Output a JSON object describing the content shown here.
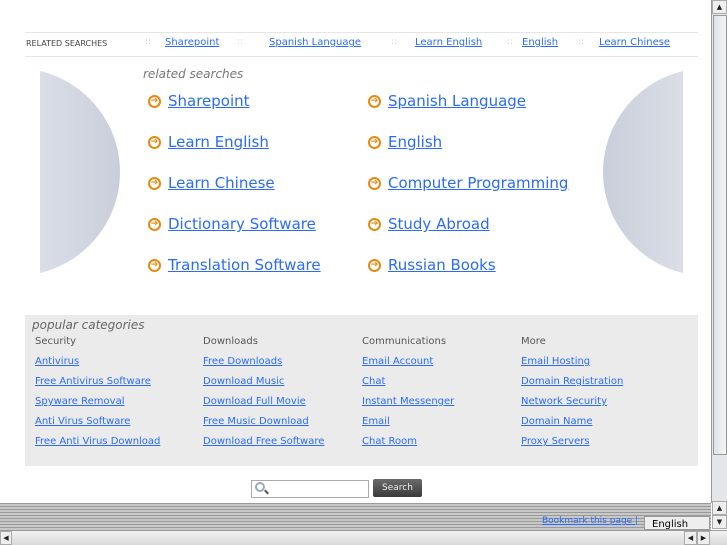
{
  "topbar": {
    "label": "RELATED SEARCHES",
    "links": [
      "Sharepoint",
      "Spanish Language",
      "Learn English",
      "English",
      "Learn Chinese"
    ],
    "separator": "::"
  },
  "related": {
    "title": "related searches",
    "left": [
      "Sharepoint",
      "Learn English",
      "Learn Chinese",
      "Dictionary Software",
      "Translation Software"
    ],
    "right": [
      "Spanish Language",
      "English",
      "Computer Programming",
      "Study Abroad",
      "Russian Books"
    ],
    "bullet": "➔"
  },
  "popular": {
    "title": "popular categories",
    "columns": [
      {
        "heading": "Security",
        "links": [
          "Antivirus",
          "Free Antivirus Software",
          "Spyware Removal",
          "Anti Virus Software",
          "Free Anti Virus Download"
        ]
      },
      {
        "heading": "Downloads",
        "links": [
          "Free Downloads",
          "Download Music",
          "Download Full Movie",
          "Free Music Download",
          "Download Free Software"
        ]
      },
      {
        "heading": "Communications",
        "links": [
          "Email Account",
          "Chat",
          "Instant Messenger",
          "Email",
          "Chat Room"
        ]
      },
      {
        "heading": "More",
        "links": [
          "Email Hosting",
          "Domain Registration",
          "Network Security",
          "Domain Name",
          "Proxy Servers"
        ]
      }
    ]
  },
  "search": {
    "button": "Search",
    "value": ""
  },
  "footer": {
    "bookmark": "Bookmark this page |",
    "language": "English"
  },
  "scroll": {
    "up": "▲",
    "down": "▼",
    "left": "◀",
    "right": "▶"
  }
}
